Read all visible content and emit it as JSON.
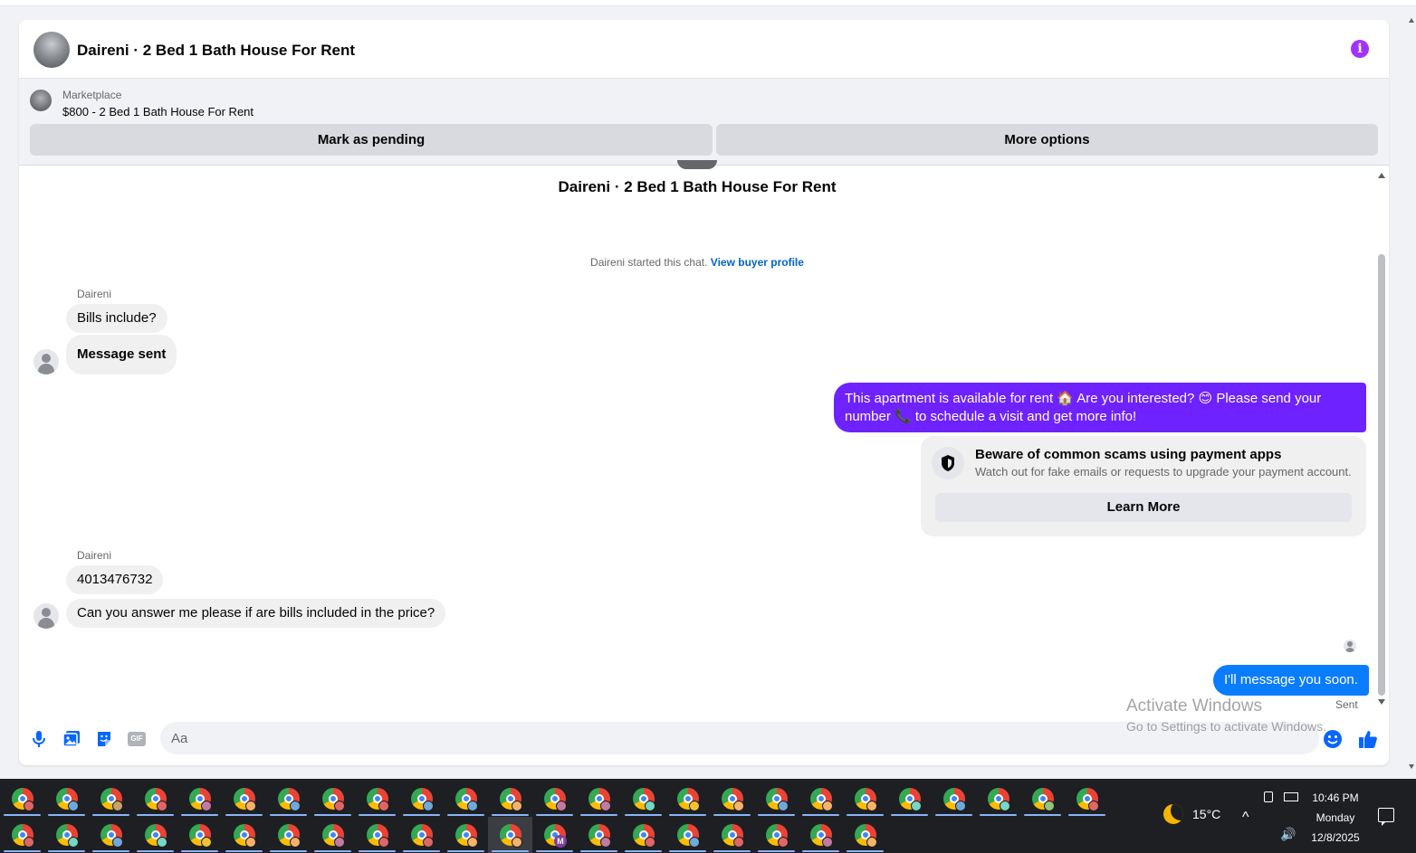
{
  "header": {
    "title": "Daireni · 2 Bed 1 Bath House For Rent"
  },
  "marketplace": {
    "label": "Marketplace",
    "listing": "$800 - 2 Bed 1 Bath House For Rent",
    "mark_pending": "Mark as pending",
    "more_options": "More options"
  },
  "chat": {
    "title": "Daireni · 2 Bed 1 Bath House For Rent",
    "started_text": "Daireni started this chat.",
    "view_profile": "View buyer profile",
    "groups": [
      {
        "sender": "Daireni",
        "messages": [
          "Bills include?",
          "Message sent"
        ]
      },
      {
        "sender": "Daireni",
        "messages": [
          "4013476732",
          "Can you answer me please if are bills included in the price?"
        ]
      }
    ],
    "outgoing_purple": "This apartment is available for rent 🏠 Are you interested? 😊 Please send your number 📞 to schedule a visit and get more info!",
    "scam": {
      "title": "Beware of common scams using payment apps",
      "text": "Watch out for fake emails or requests to upgrade your payment account.",
      "button": "Learn More"
    },
    "outgoing_blue": "I'll message you soon.",
    "sent_status": "Sent"
  },
  "composer": {
    "placeholder": "Aa",
    "icons": [
      "microphone-icon",
      "photo-icon",
      "sticker-icon",
      "gif-icon",
      "emoji-icon",
      "like-icon"
    ],
    "gif_label": "GIF"
  },
  "watermark": {
    "title": "Activate Windows",
    "subtitle": "Go to Settings to activate Windows."
  },
  "taskbar": {
    "row1_badges": [
      "#e06666",
      "#6fa8dc",
      "#c9a26b",
      "#e06666",
      "#c27ba0",
      "#f6b26b",
      "#6fa8dc",
      "#e06666",
      "#e06666",
      "#6fa8dc",
      "#6fa8dc",
      "#f6b26b",
      "#c27ba0",
      "#c27ba0",
      "#76d7c4",
      "#f1c232",
      "#f6b26b",
      "#6fa8dc",
      "#f6b26b",
      "#f6b26b",
      "#76d7c4",
      "#6fa8dc",
      "#76d7c4",
      "#93c47d",
      "#e06666"
    ],
    "row2_badges": [
      "#e06666",
      "#76d7c4",
      "#6fa8dc",
      "#76d7c4",
      "#f1c232",
      "#f6b26b",
      "#f6b26b",
      "#c27ba0",
      "#e06666",
      "#e06666",
      "#f6b26b",
      "#f6b26b",
      "M",
      "#c27ba0",
      "#e06666",
      "#6fa8dc",
      "#e06666",
      "#e06666",
      "#c27ba0",
      "#f6b26b"
    ],
    "row2_active_index": 11,
    "temperature": "15°C",
    "time": "10:46 PM",
    "day": "Monday",
    "date": "12/8/2025"
  },
  "colors": {
    "accent_purple": "#6e22ff",
    "accent_blue": "#0a7cff",
    "info_icon": "#a033ff"
  }
}
